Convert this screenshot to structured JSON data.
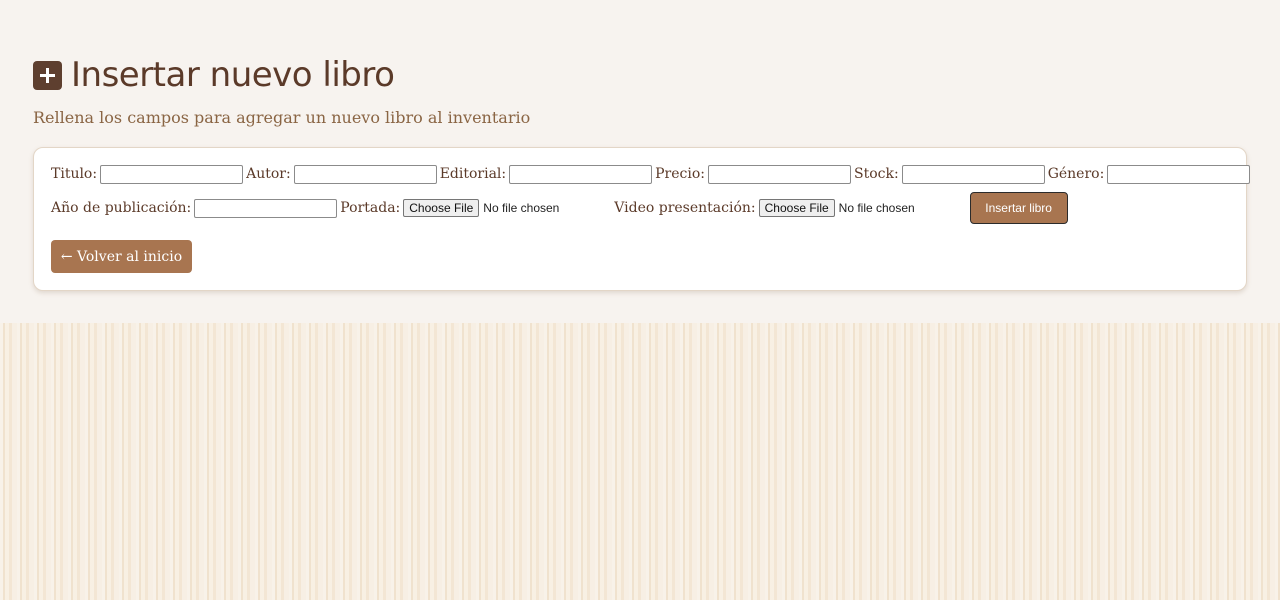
{
  "header": {
    "title": "Insertar nuevo libro",
    "subtitle": "Rellena los campos para agregar un nuevo libro al inventario",
    "icon": "plus-square-icon"
  },
  "form": {
    "fields": {
      "titulo": {
        "label": "Titulo:",
        "value": ""
      },
      "autor": {
        "label": "Autor:",
        "value": ""
      },
      "editorial": {
        "label": "Editorial:",
        "value": ""
      },
      "precio": {
        "label": "Precio:",
        "value": ""
      },
      "stock": {
        "label": "Stock:",
        "value": ""
      },
      "genero": {
        "label": "Género:",
        "value": ""
      },
      "anio": {
        "label": "Año de publicación:",
        "value": ""
      }
    },
    "portada": {
      "label": "Portada:",
      "button_label": "Choose File",
      "status": "No file chosen"
    },
    "video": {
      "label": "Video presentación:",
      "button_label": "Choose File",
      "status": "No file chosen"
    },
    "submit_label": "Insertar libro"
  },
  "nav": {
    "back_label": "← Volver al inicio"
  },
  "colors": {
    "accent": "#a87550",
    "title": "#5b3a29",
    "subtitle": "#8a6544",
    "icon_bg": "#5e3f2f"
  }
}
